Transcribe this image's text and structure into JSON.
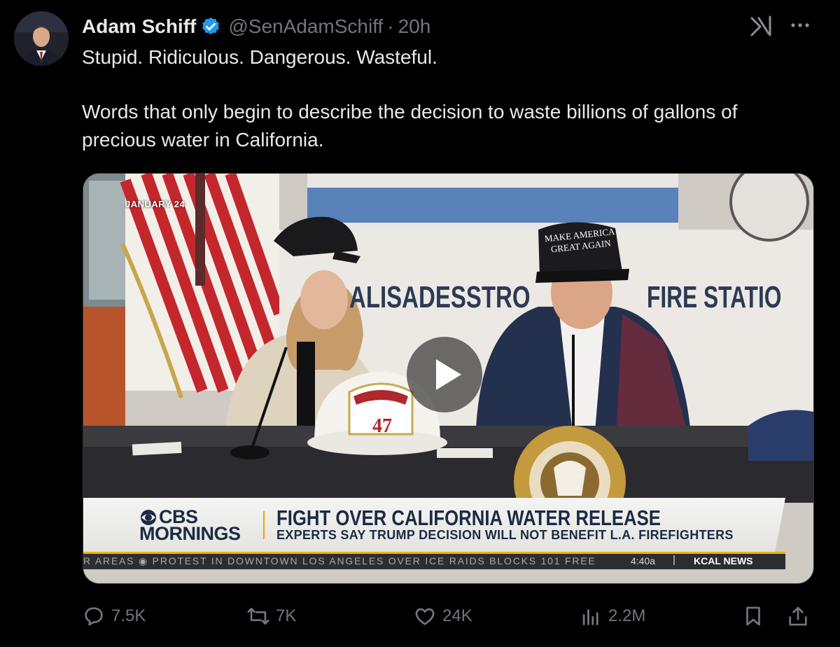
{
  "author": {
    "name": "Adam Schiff",
    "handle": "@SenAdamSchiff",
    "time": "20h"
  },
  "tweet": {
    "line1": "Stupid. Ridiculous. Dangerous. Wasteful.",
    "line2": "Words that only begin to describe the decision to waste billions of gallons of precious water in California."
  },
  "video": {
    "date_stamp": "JANUARY 24",
    "backdrop_left": "ALISADESSTRO",
    "backdrop_right": "FIRE STATIO",
    "hat_text": "MAKE AMERICA GREAT AGAIN",
    "helmet_number": "47",
    "brand_line1": "CBS",
    "brand_line2": "MORNINGS",
    "headline": "FIGHT OVER CALIFORNIA WATER RELEASE",
    "subheadline": "EXPERTS SAY TRUMP DECISION WILL NOT BENEFIT L.A. FIREFIGHTERS",
    "ticker": "R AREAS ◉ PROTEST IN DOWNTOWN LOS ANGELES OVER ICE RAIDS BLOCKS 101 FREE",
    "ticker_time": "4:40a",
    "ticker_sep": "|",
    "station": "KCAL NEWS"
  },
  "actions": {
    "replies": "7.5K",
    "reposts": "7K",
    "likes": "24K",
    "views": "2.2M"
  },
  "icons": [
    "verified-badge-icon",
    "grok-icon",
    "more-icon",
    "reply-icon",
    "repost-icon",
    "like-icon",
    "views-icon",
    "bookmark-icon",
    "share-icon",
    "play-icon"
  ],
  "colors": {
    "verified": "#1d9bf0",
    "muted": "#71767b",
    "text": "#e7e9ea",
    "background": "#000000"
  }
}
